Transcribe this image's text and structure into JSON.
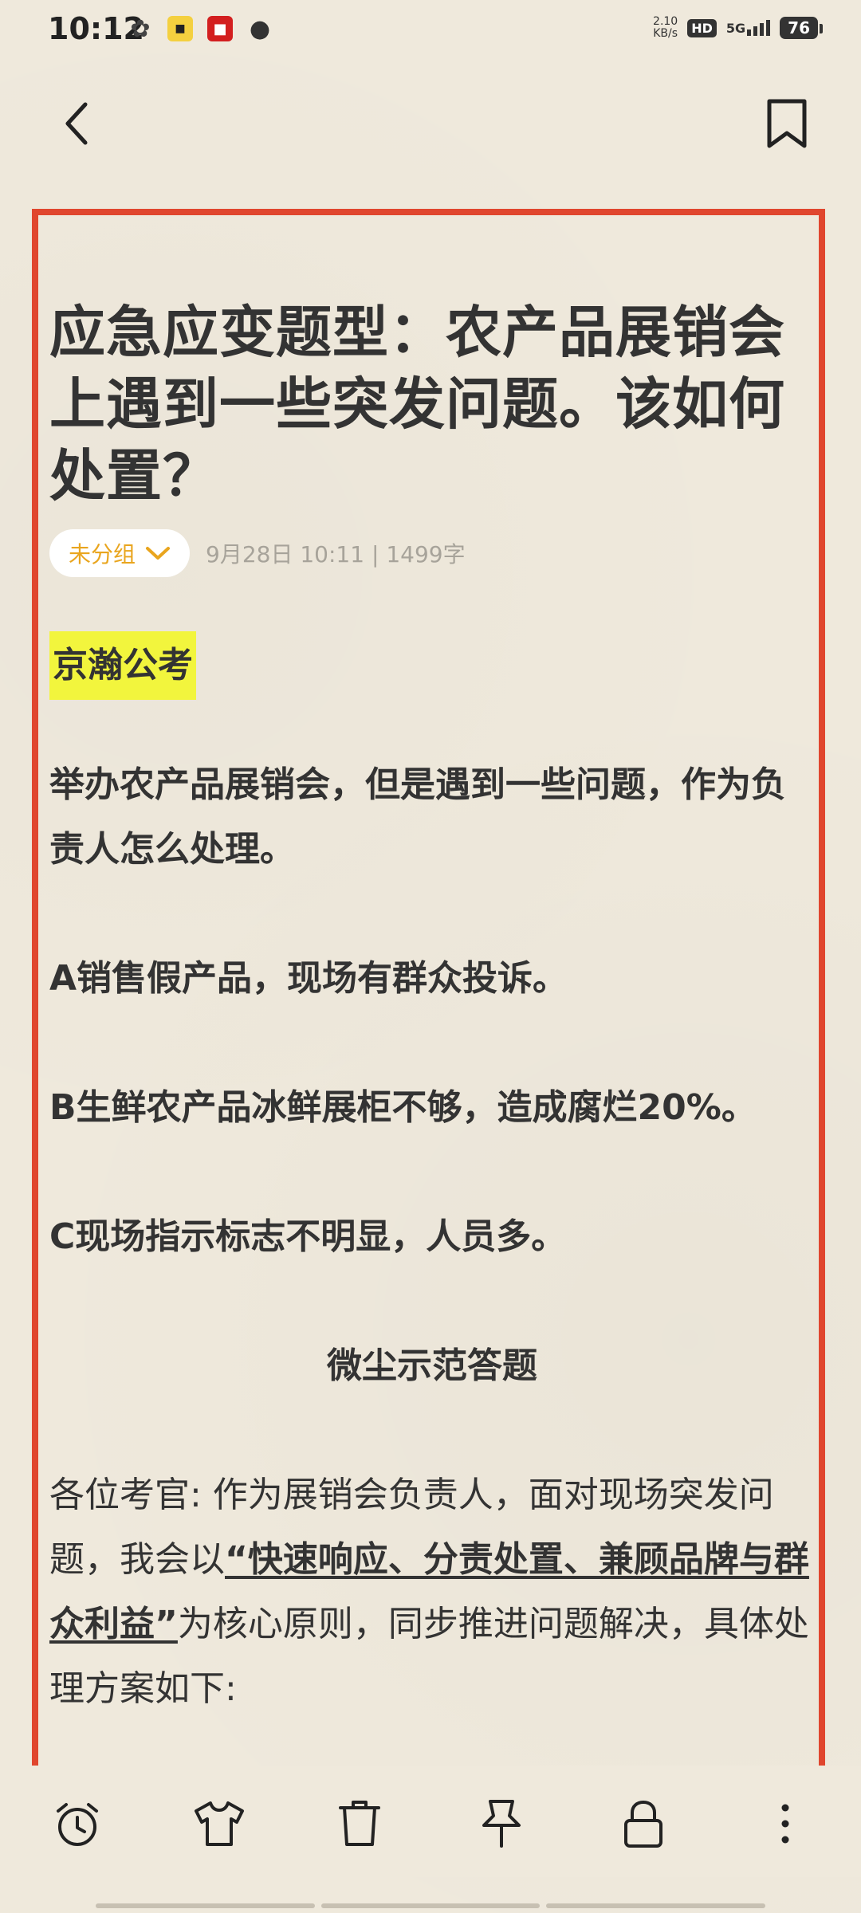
{
  "status": {
    "time": "10:12",
    "net_speed_value": "2.10",
    "net_speed_unit": "KB/s",
    "hd": "HD",
    "network": "5G",
    "battery": "76"
  },
  "nav": {
    "back_icon": "chevron-left-icon",
    "bookmark_icon": "bookmark-icon"
  },
  "note": {
    "title": "应急应变题型：农产品展销会上遇到一些突发问题。该如何处置？",
    "group_label": "未分组",
    "date": "9月28日 10:11",
    "separator": "|",
    "word_count": "1499字",
    "brand": "京瀚公考",
    "question": "举办农产品展销会，但是遇到一些问题，作为负责人怎么处理。",
    "item_a": "A销售假产品，现场有群众投诉。",
    "item_b": "B生鲜农产品冰鲜展柜不够，造成腐烂20%。",
    "item_c": "C现场指示标志不明显，人员多。",
    "section_title": "微尘示范答题",
    "answer_prefix": "各位考官: 作为展销会负责人，面对现场突发问题，我会以",
    "answer_emphasis": "“快速响应、分责处置、兼顾品牌与群众利益”",
    "answer_suffix": "为核心原则，同步推进问题解决，具体处理方案如下:"
  },
  "toolbar": {
    "alarm_icon": "alarm-clock-icon",
    "shirt_icon": "shirt-icon",
    "trash_icon": "trash-icon",
    "pin_icon": "pin-icon",
    "lock_icon": "lock-icon",
    "more_icon": "more-vertical-icon"
  },
  "colors": {
    "frame": "#e0462e",
    "highlight": "#f2f53d",
    "chip_text": "#e9a51e",
    "background": "#efe9dc"
  }
}
